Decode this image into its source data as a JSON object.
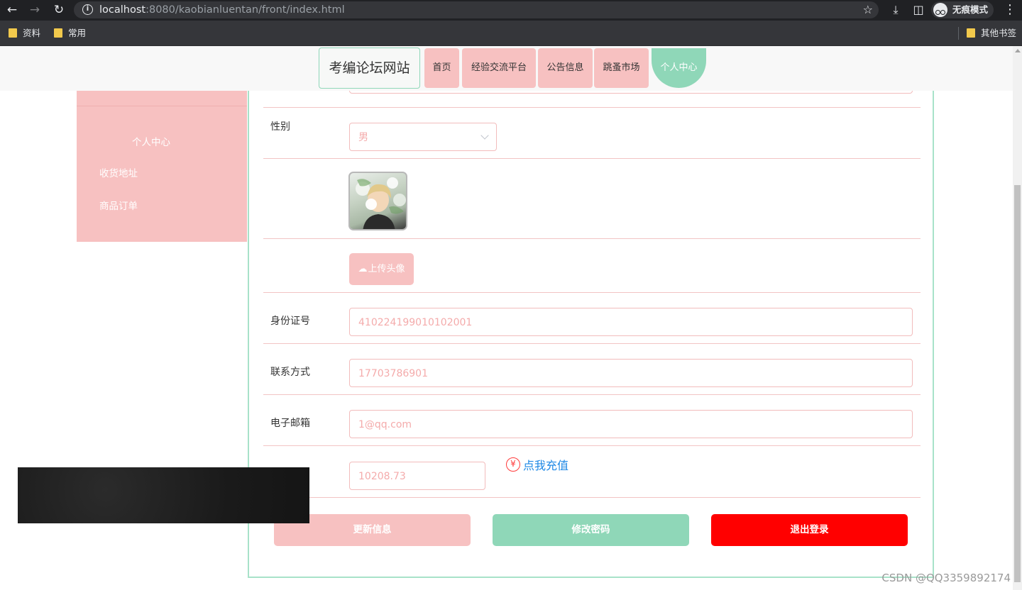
{
  "browser": {
    "url_host": "localhost",
    "url_rest": ":8080/kaobianluentan/front/index.html",
    "incognito_label": "无痕模式",
    "bookmarks": [
      "资料",
      "常用"
    ],
    "other_bookmarks": "其他书签"
  },
  "header": {
    "logo": "考编论坛网站",
    "nav": [
      "首页",
      "经验交流平台",
      "公告信息",
      "跳蚤市场"
    ],
    "active_nav": "个人中心"
  },
  "sidebar": {
    "title": "个人中心",
    "items": [
      "收货地址",
      "商品订单"
    ]
  },
  "form": {
    "gender_label": "性别",
    "gender_value": "男",
    "upload_label": "上传头像",
    "id_label": "身份证号",
    "id_value": "410224199010102001",
    "phone_label": "联系方式",
    "phone_value": "17703786901",
    "email_label": "电子邮箱",
    "email_value": "1@qq.com",
    "balance_value": "10208.73",
    "recharge_symbol": "¥",
    "recharge_text": "点我充值"
  },
  "buttons": {
    "update": "更新信息",
    "password": "修改密码",
    "logout": "退出登录"
  },
  "watermark": "CSDN @QQ3359892174",
  "colors": {
    "pink": "#f7c1c1",
    "mint": "#8fd7b8",
    "red": "#ff0000",
    "link_blue": "#1e88e5"
  }
}
